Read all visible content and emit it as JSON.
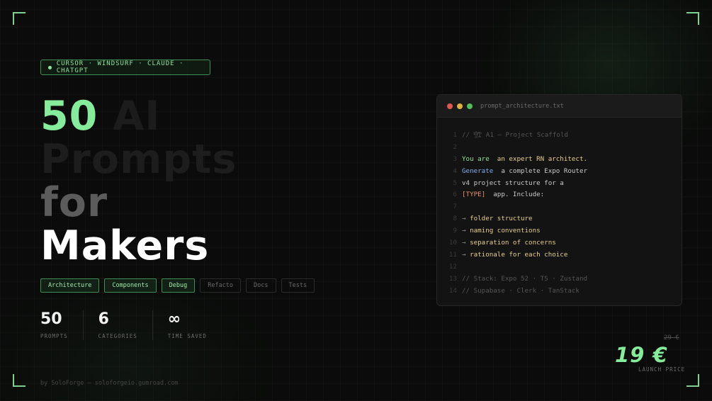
{
  "badge": {
    "text": "CURSOR · WINDSURF · CLAUDE · CHATGPT"
  },
  "headline": {
    "line1_num": "50",
    "line1_rest": " AI",
    "line2": "Prompts",
    "line3": "for",
    "line4": "Makers"
  },
  "tags": [
    {
      "label": "Architecture",
      "active": true
    },
    {
      "label": "Components",
      "active": true
    },
    {
      "label": "Debug",
      "active": true
    },
    {
      "label": "Refacto",
      "active": false
    },
    {
      "label": "Docs",
      "active": false
    },
    {
      "label": "Tests",
      "active": false
    }
  ],
  "stats": [
    {
      "value": "50",
      "label": "PROMPTS"
    },
    {
      "value": "6",
      "label": "CATEGORIES"
    },
    {
      "value": "∞",
      "label": "TIME SAVED"
    }
  ],
  "footer": {
    "text": "by SoloForge — soloforgeio.gumroad.com"
  },
  "editor": {
    "filename": "prompt_architecture.txt",
    "lines": [
      {
        "n": "1",
        "parts": [
          {
            "t": "// 🏗 A1 — Project Scaffold",
            "c": "comment"
          }
        ]
      },
      {
        "n": "2",
        "parts": []
      },
      {
        "n": "3",
        "parts": [
          {
            "t": "You are",
            "c": "green"
          },
          {
            "t": "  an expert RN architect.",
            "c": "yellow"
          }
        ]
      },
      {
        "n": "4",
        "parts": [
          {
            "t": "Generate",
            "c": "blue"
          },
          {
            "t": "  a complete Expo Router",
            "c": "white"
          }
        ]
      },
      {
        "n": "5",
        "parts": [
          {
            "t": "v4 project structure for a",
            "c": "white"
          }
        ]
      },
      {
        "n": "6",
        "parts": [
          {
            "t": "[TYPE]",
            "c": "orange"
          },
          {
            "t": "  app. Include:",
            "c": "white"
          }
        ]
      },
      {
        "n": "7",
        "parts": []
      },
      {
        "n": "8",
        "parts": [
          {
            "t": "→ ",
            "c": "arrow"
          },
          {
            "t": "folder structure",
            "c": "yellow"
          }
        ]
      },
      {
        "n": "9",
        "parts": [
          {
            "t": "→ ",
            "c": "arrow"
          },
          {
            "t": "naming conventions",
            "c": "yellow"
          }
        ]
      },
      {
        "n": "10",
        "parts": [
          {
            "t": "→ ",
            "c": "arrow"
          },
          {
            "t": "separation of concerns",
            "c": "yellow"
          }
        ]
      },
      {
        "n": "11",
        "parts": [
          {
            "t": "→ ",
            "c": "arrow"
          },
          {
            "t": "rationale for each choice",
            "c": "yellow"
          }
        ]
      },
      {
        "n": "12",
        "parts": []
      },
      {
        "n": "13",
        "parts": [
          {
            "t": "// Stack: Expo 52 · TS · Zustand",
            "c": "comment"
          }
        ]
      },
      {
        "n": "14",
        "parts": [
          {
            "t": "// Supabase · Clerk · TanStack",
            "c": "comment"
          }
        ]
      }
    ]
  },
  "pricing": {
    "old_price": "29 €",
    "price": "19 €",
    "label": "LAUNCH PRICE"
  },
  "colors": {
    "accent": "#84ec9a",
    "background": "#0a0b0a",
    "traffic_red": "#e0584f",
    "traffic_yellow": "#e0b040",
    "traffic_green": "#4fbf5a"
  }
}
